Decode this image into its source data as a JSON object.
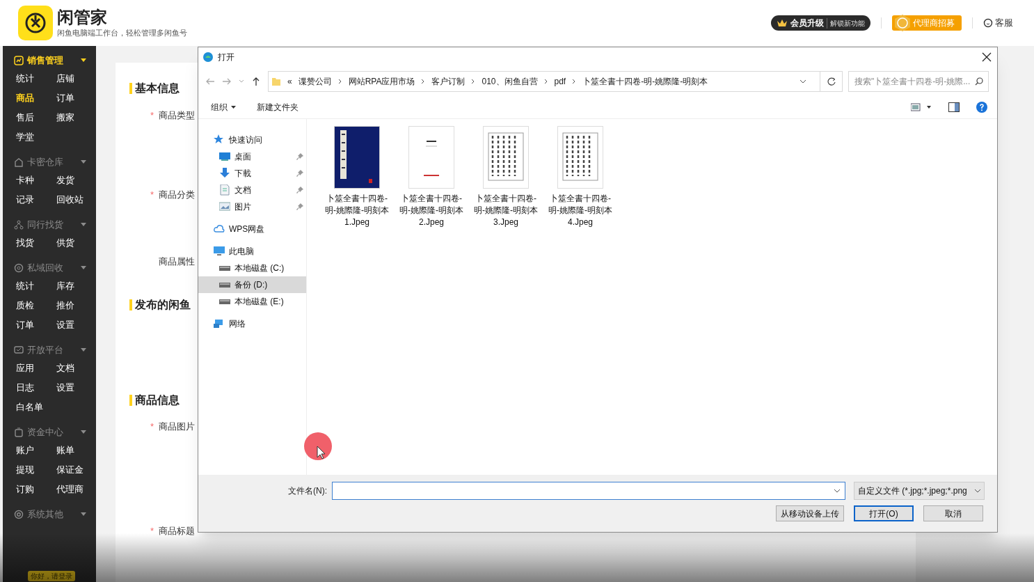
{
  "header": {
    "app_name": "闲管家",
    "tagline": "闲鱼电脑端工作台，轻松管理多闲鱼号",
    "member": {
      "label": "会员升级",
      "sub": "解锁新功能"
    },
    "agent": "代理商招募",
    "service": "客服"
  },
  "sidebar": [
    {
      "title": "销售管理",
      "expanded": true,
      "active": true,
      "items": [
        {
          "label": "统计",
          "selected": false
        },
        {
          "label": "店铺",
          "selected": false
        },
        {
          "label": "商品",
          "selected": true
        },
        {
          "label": "订单",
          "selected": false
        },
        {
          "label": "售后",
          "selected": false
        },
        {
          "label": "搬家",
          "selected": false
        },
        {
          "label": "学堂",
          "selected": false
        }
      ]
    },
    {
      "title": "卡密仓库",
      "expanded": true,
      "active": false,
      "items": [
        {
          "label": "卡种",
          "selected": false
        },
        {
          "label": "发货",
          "selected": false
        },
        {
          "label": "记录",
          "selected": false
        },
        {
          "label": "回收站",
          "selected": false
        }
      ]
    },
    {
      "title": "同行找货",
      "expanded": true,
      "active": false,
      "items": [
        {
          "label": "找货",
          "selected": false
        },
        {
          "label": "供货",
          "selected": false
        }
      ]
    },
    {
      "title": "私域回收",
      "expanded": true,
      "active": false,
      "items": [
        {
          "label": "统计",
          "selected": false
        },
        {
          "label": "库存",
          "selected": false
        },
        {
          "label": "质检",
          "selected": false
        },
        {
          "label": "推价",
          "selected": false
        },
        {
          "label": "订单",
          "selected": false
        },
        {
          "label": "设置",
          "selected": false
        }
      ]
    },
    {
      "title": "开放平台",
      "expanded": true,
      "active": false,
      "items": [
        {
          "label": "应用",
          "selected": false
        },
        {
          "label": "文档",
          "selected": false
        },
        {
          "label": "日志",
          "selected": false
        },
        {
          "label": "设置",
          "selected": false
        },
        {
          "label": "白名单",
          "selected": false
        }
      ]
    },
    {
      "title": "资金中心",
      "expanded": true,
      "active": false,
      "items": [
        {
          "label": "账户",
          "selected": false
        },
        {
          "label": "账单",
          "selected": false
        },
        {
          "label": "提现",
          "selected": false
        },
        {
          "label": "保证金",
          "selected": false
        },
        {
          "label": "订购",
          "selected": false
        },
        {
          "label": "代理商",
          "selected": false
        }
      ]
    },
    {
      "title": "系统其他",
      "expanded": true,
      "active": false
    }
  ],
  "login_badge": "你好，请登录",
  "form": [
    {
      "kind": "section",
      "text": "基本信息"
    },
    {
      "kind": "field",
      "mark": "*",
      "text": "商品类型"
    },
    {
      "kind": "field",
      "mark": "*",
      "text": "商品分类"
    },
    {
      "kind": "field",
      "text": "商品属性"
    },
    {
      "kind": "section",
      "text": "发布的闲鱼"
    },
    {
      "kind": "section",
      "text": "商品信息"
    },
    {
      "kind": "field",
      "mark": "*",
      "text": "商品图片"
    },
    {
      "kind": "field",
      "mark": "*",
      "text": "商品标题"
    }
  ],
  "dialog": {
    "title": "打开",
    "path": [
      "«",
      "谍赞公司",
      "网站RPA应用市场",
      "客户订制",
      "010、闲鱼自营",
      "pdf",
      "卜筮全書十四卷-明-姚際隆-明刻本"
    ],
    "search": {
      "placeholder": "搜索\"卜筮全書十四卷-明-姚際..."
    },
    "toolbar": [
      "组织",
      "新建文件夹"
    ],
    "nav": [
      {
        "label": "快速访问",
        "selected": false,
        "children": [
          {
            "label": "桌面",
            "pinned": true,
            "selected": false
          },
          {
            "label": "下載",
            "pinned": true,
            "selected": false
          },
          {
            "label": "文档",
            "pinned": true,
            "selected": false
          },
          {
            "label": "图片",
            "pinned": true,
            "selected": false
          }
        ]
      },
      {
        "label": "WPS网盘",
        "selected": false
      },
      {
        "label": "此电脑",
        "selected": false,
        "children": [
          {
            "label": "本地磁盘 (C:)",
            "pinned": false,
            "selected": false
          },
          {
            "label": "备份 (D:)",
            "pinned": false,
            "selected": true
          },
          {
            "label": "本地磁盘 (E:)",
            "pinned": false,
            "selected": false
          }
        ]
      },
      {
        "label": "网络",
        "selected": false
      }
    ],
    "files": [
      {
        "name": "卜筮全書十四卷-明-姚際隆-明刻本1.Jpeg"
      },
      {
        "name": "卜筮全書十四卷-明-姚際隆-明刻本2.Jpeg"
      },
      {
        "name": "卜筮全書十四卷-明-姚際隆-明刻本3.Jpeg"
      },
      {
        "name": "卜筮全書十四卷-明-姚際隆-明刻本4.Jpeg"
      }
    ],
    "filename_label": "文件名(N):",
    "file_type": "自定义文件 (*.jpg;*.jpeg;*.png",
    "buttons": [
      {
        "label": "从移动设备上传",
        "default": false
      },
      {
        "label": "打开(O)",
        "default": true
      },
      {
        "label": "取消",
        "default": false
      }
    ]
  }
}
